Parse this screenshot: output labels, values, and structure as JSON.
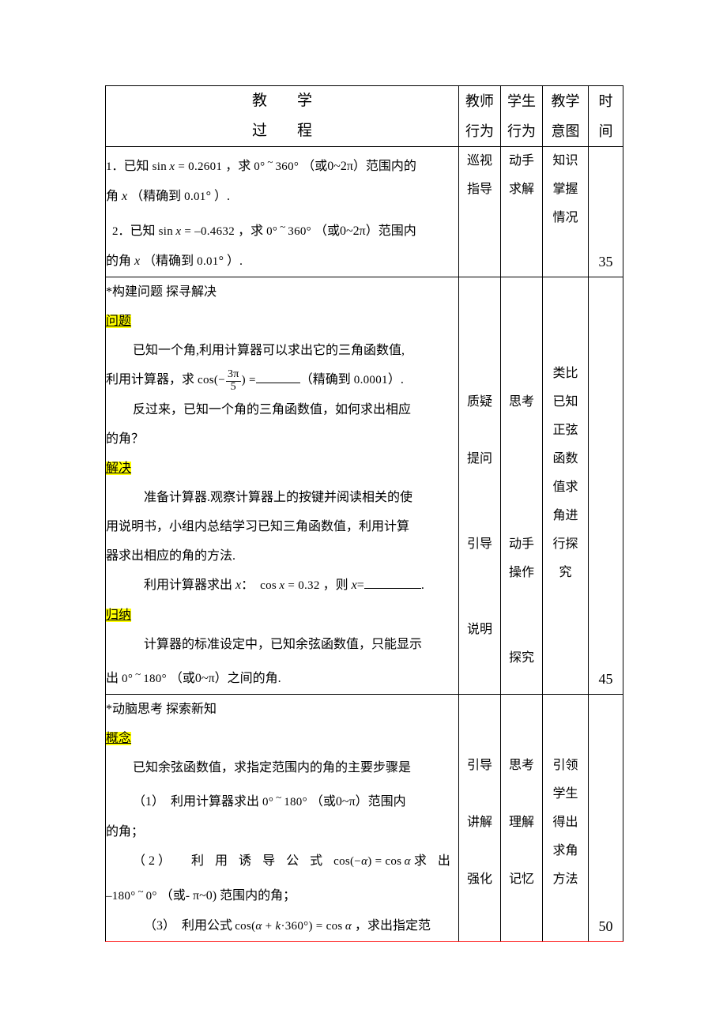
{
  "document": {
    "type": "lesson-plan-table"
  },
  "table": {
    "headers": {
      "main_line1": "教　　学",
      "main_line2": "过　　程",
      "teacher_l1": "教师",
      "teacher_l2": "行为",
      "student_l1": "学生",
      "student_l2": "行为",
      "intent_l1": "教学",
      "intent_l2": "意图",
      "time_l1": "时",
      "time_l2": "间"
    },
    "rows": [
      {
        "id": "row-exercises",
        "main_lines": [
          "1．已知 sin x = 0.2601 ，求 0° ~ 360° （或0~2π）范围内的",
          "角 x （精确到 0.01° ）.",
          "2．已知 sin x = −0.4632 ，求 0° ~ 360° （或0~2π）范围内",
          "的角 x （精确到 0.01° ）."
        ],
        "teacher": [
          "巡视",
          "指导"
        ],
        "student": [
          "动手",
          "求解"
        ],
        "intent": [
          "知识",
          "掌握",
          "情况"
        ],
        "time": "35"
      },
      {
        "id": "row-construct-problem",
        "section_title": "*构建问题  探寻解决",
        "headings": [
          {
            "label": "问题",
            "highlight": "#ffff00"
          },
          {
            "label": "解决",
            "highlight": "#ffff00"
          },
          {
            "label": "归纳",
            "highlight": "#ffff00"
          }
        ],
        "main_lines": [
          "已知一个角,利用计算器可以求出它的三角函数值,",
          "利用计算器，求 cos(−3π/5) = ____（精确到 0.0001）.",
          "反过来，已知一个角的三角函数值，如何求出相应",
          "的角？",
          "准备计算器.观察计算器上的按键并阅读相关的使",
          "用说明书，小组内总结学习已知三角函数值，利用计算",
          "器求出相应的角的方法.",
          "利用计算器求出 x： cos x = 0.32 ，则 x=________.",
          "计算器的标准设定中，已知余弦函数值，只能显示",
          "出 0° ~ 180° （或0~π）之间的角."
        ],
        "teacher": [
          "质疑",
          "提问",
          "引导",
          "说明"
        ],
        "student": [
          "思考",
          "动手",
          "操作",
          "探究"
        ],
        "intent": [
          "类比",
          "已知",
          "正弦",
          "函数",
          "值求",
          "角进",
          "行探",
          "究"
        ],
        "time": "45"
      },
      {
        "id": "row-new-knowledge",
        "section_title": "*动脑思考  探索新知",
        "headings": [
          {
            "label": "概念",
            "highlight": "#ffff00"
          }
        ],
        "main_lines": [
          "已知余弦函数值，求指定范围内的角的主要步骤是",
          "（1） 利用计算器求出 0°~180° （或0~π）范围内",
          "的角；",
          "（2） 利用诱导公式 cos(−α) = cos α 求出",
          "−180° ~0° （或- π~0) 范围内的角；",
          "（3） 利用公式 cos(α + k·360°) = cos α ，求出指定范"
        ],
        "teacher": [
          "引导",
          "讲解",
          "强化"
        ],
        "student": [
          "思考",
          "理解",
          "记忆"
        ],
        "intent": [
          "引领",
          "学生",
          "得出",
          "求角",
          "方法"
        ],
        "time": "50"
      }
    ]
  },
  "math": {
    "sin_label": "sin",
    "cos_label": "cos",
    "var_x": "x",
    "alpha": "α",
    "pi": "π",
    "k": "k",
    "val1": "0.2601",
    "val2": "–0.4632",
    "val3": "0.32",
    "precision1": "0.01",
    "precision2": "0.0001",
    "deg0": "0",
    "deg360": "360",
    "deg180": "180",
    "deg_neg180": "–180",
    "frac_num": "3π",
    "frac_den": "5"
  },
  "colors": {
    "highlight": "#ffff00",
    "section_separator": "#ff2020",
    "border": "#000000",
    "text": "#000000"
  }
}
